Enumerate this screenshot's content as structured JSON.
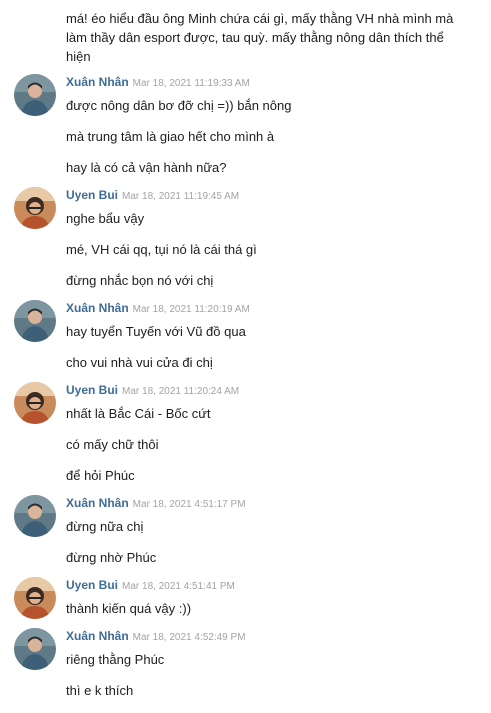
{
  "chat": {
    "continued_message": "má! éo hiểu đầu ông Minh chứa cái gì, mấy thằng VH nhà mình mà làm thầy dân esport được, tau quỳ. mấy thằng nông dân thích thể hiện",
    "groups": [
      {
        "author": "Xuân Nhân",
        "time": "Mar 18, 2021 11:19:33 AM",
        "avatar": "xuan-nhan",
        "messages": [
          "được nông dân bơ đỡ chị =)) bắn nông",
          "mà trung tâm là giao hết cho mình à",
          "hay là có cả vận hành nữa?"
        ]
      },
      {
        "author": "Uyen Bui",
        "time": "Mar 18, 2021 11:19:45 AM",
        "avatar": "uyen-bui",
        "messages": [
          "nghe bẩu vậy",
          "mé, VH cái qq, tụi nó là cái thá gì",
          "đừng nhắc bọn nó với chị"
        ]
      },
      {
        "author": "Xuân Nhân",
        "time": "Mar 18, 2021 11:20:19 AM",
        "avatar": "xuan-nhan",
        "messages": [
          "hay tuyển Tuyến với Vũ đồ qua",
          "cho vui nhà vui cửa đi chị"
        ]
      },
      {
        "author": "Uyen Bui",
        "time": "Mar 18, 2021 11:20:24 AM",
        "avatar": "uyen-bui",
        "messages": [
          "nhất là Bắc Cái - Bốc cứt",
          "có mấy chữ thôi",
          "để hỏi Phúc"
        ]
      },
      {
        "author": "Xuân Nhân",
        "time": "Mar 18, 2021 4:51:17 PM",
        "avatar": "xuan-nhan",
        "messages": [
          "đừng nữa chị",
          "đừng nhờ Phúc"
        ]
      },
      {
        "author": "Uyen Bui",
        "time": "Mar 18, 2021 4:51:41 PM",
        "avatar": "uyen-bui",
        "messages": [
          "thành kiến quá vậy :))"
        ]
      },
      {
        "author": "Xuân Nhân",
        "time": "Mar 18, 2021 4:52:49 PM",
        "avatar": "xuan-nhan",
        "messages": [
          "riêng thằng Phúc",
          "thì e k thích"
        ]
      }
    ]
  },
  "colors": {
    "author": "#3e6c98",
    "timestamp": "#a3a3a3",
    "text": "#1d1d1d",
    "background": "#ffffff"
  }
}
